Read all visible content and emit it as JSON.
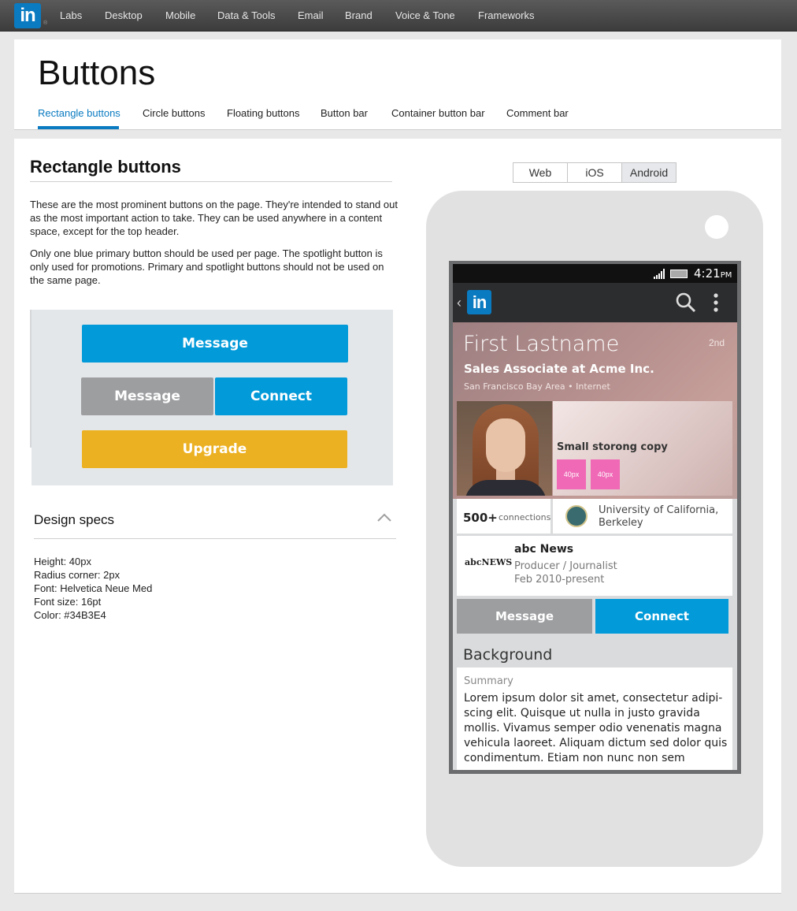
{
  "brand": {
    "logo_text": "in",
    "reg_mark": "®"
  },
  "nav": [
    "Labs",
    "Desktop",
    "Mobile",
    "Data & Tools",
    "Email",
    "Brand",
    "Voice & Tone",
    "Frameworks"
  ],
  "header": {
    "title": "Buttons",
    "tabs": [
      "Rectangle buttons",
      "Circle buttons",
      "Floating buttons",
      "Button bar",
      "Container button bar",
      "Comment bar"
    ],
    "active_tab": "Rectangle buttons"
  },
  "section": {
    "title": "Rectangle buttons",
    "paragraphs": [
      "These are the most prominent buttons on the page. They're intended to stand out as the most important action to take. They can be used anywhere in a content space, except for the top header.",
      "Only one blue primary button should be used per page. The spotlight button is only used for promotions. Primary and spotlight buttons should not be used on the same page."
    ]
  },
  "demo": {
    "primary": "Message",
    "secondary": "Message",
    "connect": "Connect",
    "upgrade": "Upgrade"
  },
  "specs": {
    "title": "Design specs",
    "lines": [
      "Height: 40px",
      "Radius corner: 2px",
      "Font: Helvetica Neue Med",
      "Font size: 16pt",
      "Color: #34B3E4"
    ]
  },
  "platforms": {
    "options": [
      "Web",
      "iOS",
      "Android"
    ],
    "selected": "Android"
  },
  "phone": {
    "time": "4:21",
    "ampm": "PM",
    "back": "‹",
    "logo_text": "in",
    "name": "First Lastname",
    "degree": "2nd",
    "headline": "Sales Associate at Acme Inc.",
    "location": "San Francisco Bay Area • Internet",
    "copy": "Small storong copy",
    "pink_label": "40px",
    "connections_count": "500+",
    "connections_label": "connections",
    "school": "University of California, Berkeley",
    "company_logo": "abcNEWS",
    "company": "abc News",
    "role": "Producer / Journalist",
    "dates": "Feb 2010-present",
    "message_btn": "Message",
    "connect_btn": "Connect",
    "background_title": "Background",
    "summary_label": "Summary",
    "summary": "Lorem ipsum dolor sit amet, consectetur adipi-scing elit. Quisque ut nulla in justo gravida mollis. Vivamus semper odio venenatis magna vehicula laoreet. Aliquam dictum sed dolor quis condimentum. Etiam non nunc non sem"
  },
  "colors": {
    "linkedin_blue": "#0a7bc1",
    "primary": "#029ad9",
    "secondary": "#9d9ea0",
    "spotlight": "#ecb122",
    "pink": "#f069b6"
  }
}
